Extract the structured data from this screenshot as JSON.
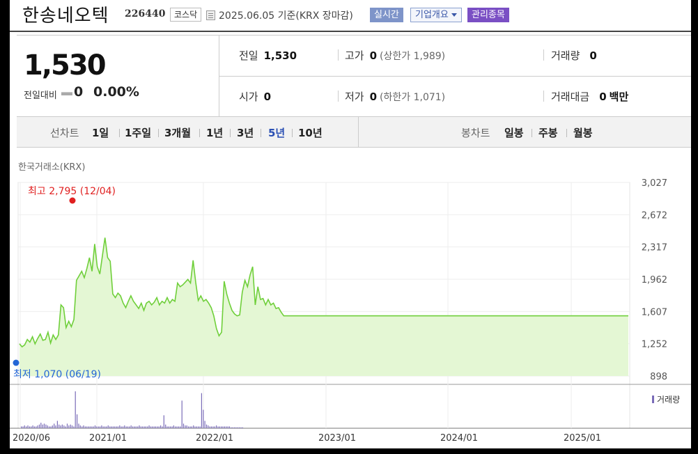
{
  "header": {
    "stock_name": "한송네오텍",
    "stock_code": "226440",
    "market": "코스닥",
    "date_text": "2025.06.05  기준(KRX 장마감)",
    "realtime_btn": "실시간",
    "company_btn": "기업개요",
    "managed_btn": "관리종목"
  },
  "price": {
    "current": "1,530",
    "change_label": "전일대비",
    "change_value": "0",
    "change_pct": "0.00%",
    "prev_label": "전일",
    "prev_value": "1,530",
    "high_label": "고가",
    "high_value": "0",
    "high_limit": "(상한가 1,989)",
    "volume_label": "거래량",
    "volume_value": "0",
    "open_label": "시가",
    "open_value": "0",
    "low_label": "저가",
    "low_value": "0",
    "low_limit": "(하한가 1,071)",
    "amount_label": "거래대금",
    "amount_value": "0",
    "amount_unit": "백만"
  },
  "tabs": {
    "line_label": "선차트",
    "line_periods": [
      "1일",
      "1주일",
      "3개월",
      "1년",
      "3년",
      "5년",
      "10년"
    ],
    "active_period": "5년",
    "candle_label": "봉차트",
    "candle_periods": [
      "일봉",
      "주봉",
      "월봉"
    ]
  },
  "chart_data": {
    "type": "area",
    "source_label": "한국거래소(KRX)",
    "y_ticks": [
      "3,027",
      "2,672",
      "2,317",
      "1,962",
      "1,607",
      "1,252",
      "898"
    ],
    "ylim": [
      898,
      3027
    ],
    "x_ticks": [
      "2020/06",
      "2021/01",
      "2022/01",
      "2023/01",
      "2024/01",
      "2025/01"
    ],
    "high_annotation": "최고 2,795 (12/04)",
    "low_annotation": "최저 1,070 (06/19)",
    "volume_legend": "거래량",
    "colors": {
      "line": "#6fcf3a",
      "fill": "#e4f7d4",
      "high": "#e02020",
      "low": "#2466d6",
      "volume": "#7a6cb8"
    },
    "series": [
      {
        "values": [
          1252,
          1220,
          1240,
          1300,
          1270,
          1330,
          1252,
          1310,
          1360,
          1290,
          1300,
          1380,
          1260,
          1350,
          1300,
          1350,
          1680,
          1650,
          1430,
          1500,
          1440,
          1520,
          1950,
          2000,
          2050,
          1980,
          2080,
          2200,
          2050,
          2350,
          2100,
          2020,
          2220,
          2420,
          2200,
          2160,
          1800,
          1760,
          1810,
          1780,
          1700,
          1650,
          1720,
          1780,
          1720,
          1680,
          1640,
          1700,
          1620,
          1700,
          1720,
          1680,
          1710,
          1760,
          1680,
          1720,
          1700,
          1760,
          1700,
          1740,
          1720,
          1920,
          1880,
          1900,
          1930,
          1960,
          1920,
          2170,
          1930,
          1730,
          1780,
          1720,
          1740,
          1700,
          1650,
          1560,
          1420,
          1340,
          1380,
          1940,
          1800,
          1700,
          1620,
          1580,
          1560,
          1570,
          1820,
          1950,
          1880,
          2010,
          2100,
          1680,
          1880,
          1740,
          1750,
          1680,
          1740,
          1680,
          1700,
          1640,
          1650,
          1600,
          1560,
          1560,
          1560,
          1560,
          1560,
          1560,
          1560,
          1560,
          1560,
          1560,
          1560,
          1560,
          1560,
          1560,
          1560,
          1560,
          1560,
          1560,
          1560,
          1560,
          1560,
          1560,
          1560,
          1560,
          1560,
          1560,
          1560,
          1560,
          1560,
          1560,
          1560,
          1560,
          1560,
          1560,
          1560,
          1560,
          1560,
          1560,
          1560,
          1560,
          1560,
          1560,
          1560,
          1560,
          1560,
          1560,
          1560,
          1560,
          1560,
          1560,
          1560,
          1560,
          1560,
          1560,
          1560,
          1560,
          1560,
          1560,
          1560,
          1560,
          1560,
          1560,
          1560,
          1560,
          1560,
          1560,
          1560,
          1560,
          1560,
          1560,
          1560,
          1560,
          1560,
          1560,
          1560,
          1560,
          1560,
          1560,
          1560,
          1560,
          1560,
          1560,
          1560,
          1560,
          1560,
          1560,
          1560,
          1560,
          1560,
          1560,
          1560,
          1560,
          1560,
          1560,
          1560,
          1560,
          1560,
          1560,
          1560,
          1560,
          1560,
          1560,
          1560,
          1560,
          1560,
          1560,
          1560,
          1560,
          1560,
          1560,
          1560,
          1560,
          1560,
          1560,
          1560,
          1560,
          1560,
          1560,
          1560,
          1560,
          1560,
          1560,
          1560,
          1560,
          1560,
          1560,
          1560,
          1560,
          1560,
          1560,
          1560,
          1560,
          1560,
          1560
        ]
      }
    ],
    "volume": [
      2,
      2,
      3,
      2,
      3,
      2,
      2,
      3,
      2,
      2,
      3,
      4,
      6,
      4,
      5,
      4,
      3,
      2,
      2,
      3,
      5,
      3,
      8,
      4,
      3,
      4,
      3,
      2,
      5,
      3,
      4,
      3,
      2,
      40,
      15,
      5,
      3,
      2,
      3,
      2,
      2,
      2,
      2,
      2,
      2,
      3,
      2,
      2,
      2,
      3,
      2,
      2,
      2,
      3,
      2,
      2,
      2,
      2,
      2,
      2,
      3,
      2,
      2,
      3,
      2,
      2,
      2,
      3,
      2,
      2,
      2,
      2,
      3,
      2,
      2,
      2,
      2,
      2,
      3,
      2,
      2,
      2,
      2,
      2,
      2,
      3,
      2,
      14,
      4,
      2,
      2,
      2,
      2,
      3,
      2,
      2,
      2,
      2,
      30,
      5,
      3,
      3,
      2,
      2,
      2,
      3,
      2,
      2,
      2,
      2,
      38,
      20,
      8,
      4,
      3,
      2,
      2,
      2,
      2,
      3,
      2,
      2,
      2,
      2,
      2,
      2,
      2,
      2,
      1,
      1,
      1,
      1,
      1,
      1,
      1,
      1
    ]
  }
}
